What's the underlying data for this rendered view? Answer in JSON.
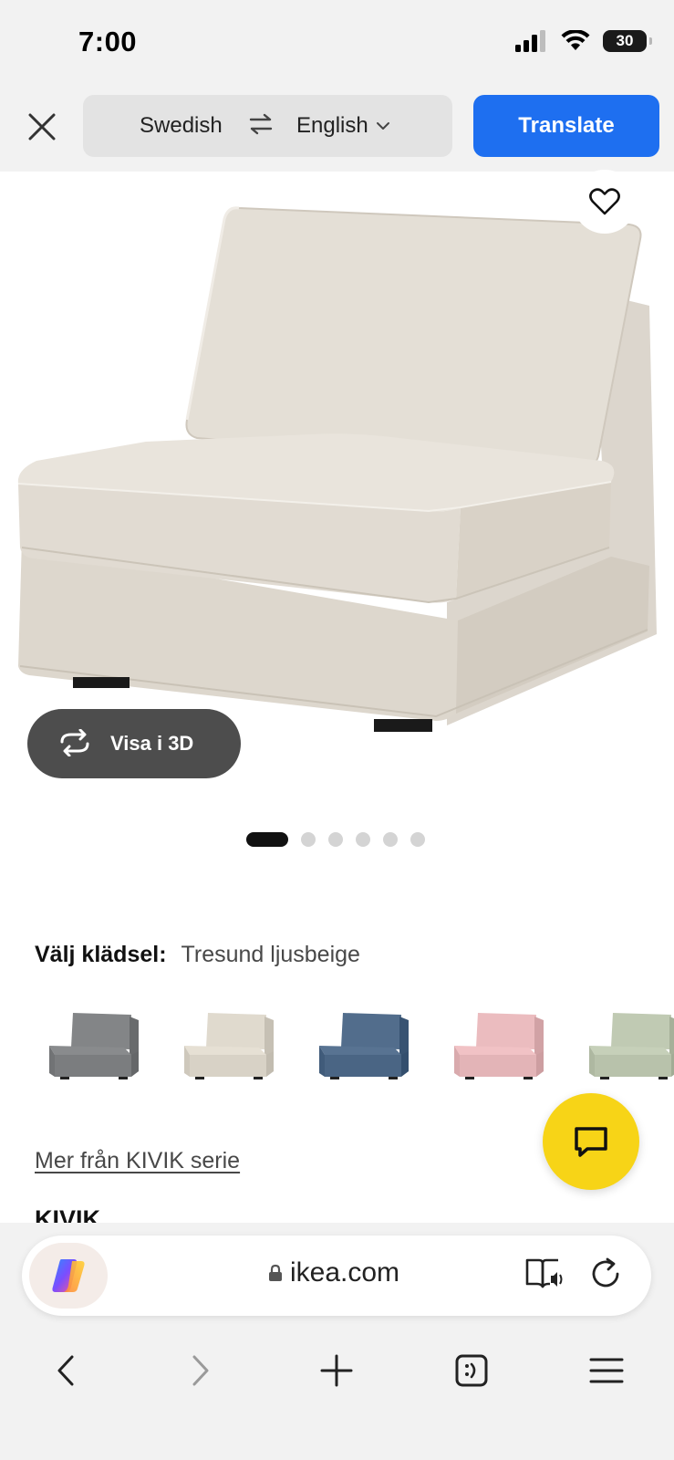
{
  "status_bar": {
    "time": "7:00",
    "battery": "30"
  },
  "translate_bar": {
    "source_language": "Swedish",
    "target_language": "English",
    "translate_label": "Translate"
  },
  "hero": {
    "view_3d_label": "Visa i 3D",
    "carousel": {
      "total": 6,
      "active": 1
    }
  },
  "product": {
    "fabric_label": "Välj klädsel:",
    "fabric_value": "Tresund ljusbeige",
    "swatches": [
      {
        "color": "#7b7d7f"
      },
      {
        "color": "#d8d2c6"
      },
      {
        "color": "#4a6584"
      },
      {
        "color": "#e3b4b7"
      },
      {
        "color": "#b8c2ab"
      }
    ],
    "series_link": "Mer från KIVIK serie",
    "name": "KIVIK"
  },
  "browser": {
    "url": "ikea.com"
  },
  "colors": {
    "accent_blue": "#1e6ff0",
    "chat_yellow": "#f7d417",
    "dark_pill": "#4d4d4d"
  }
}
